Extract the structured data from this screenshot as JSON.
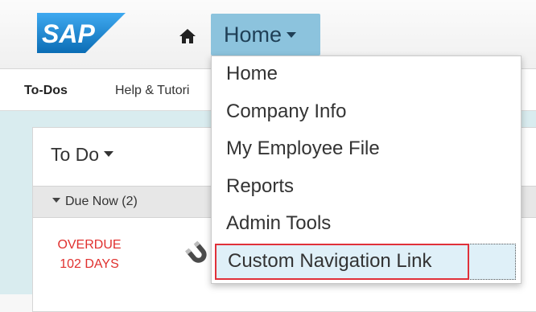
{
  "header": {
    "logo_text": "SAP",
    "home_icon": "home-icon",
    "menu_button_label": "Home",
    "colors": {
      "menu_button_bg": "#8cc3dd",
      "logo_blue": "#1b84c8"
    }
  },
  "subbar": {
    "items": [
      {
        "label": "To-Dos"
      },
      {
        "label": "Help & Tutori"
      }
    ]
  },
  "todo": {
    "title": "To Do",
    "due_label": "Due Now (2)",
    "overdue_line1": "OVERDUE",
    "overdue_line2": "102 DAYS",
    "task_icon": "magnet-icon"
  },
  "dropdown": {
    "items": [
      {
        "label": "Home"
      },
      {
        "label": "Company Info"
      },
      {
        "label": "My Employee File"
      },
      {
        "label": "Reports"
      },
      {
        "label": "Admin Tools"
      },
      {
        "label": "Custom Navigation Link",
        "highlighted": true
      }
    ],
    "highlight_color": "#e0313a"
  }
}
